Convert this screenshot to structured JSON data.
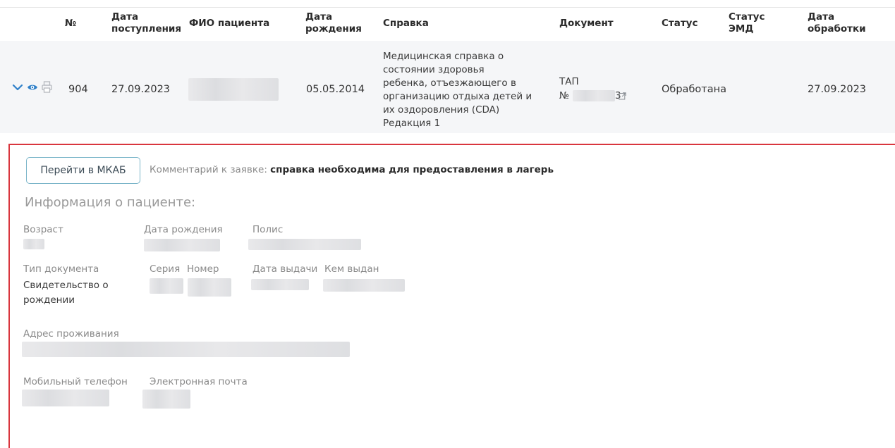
{
  "table": {
    "headers": {
      "num": "№",
      "admission_l1": "Дата",
      "admission_l2": "поступления",
      "patient": "ФИО пациента",
      "birth_l1": "Дата",
      "birth_l2": "рождения",
      "certificate": "Справка",
      "document": "Документ",
      "status": "Статус",
      "emd_l1": "Статус",
      "emd_l2": "ЭМД",
      "processed_l1": "Дата",
      "processed_l2": "обработки"
    },
    "row": {
      "num": "904",
      "admission_date": "27.09.2023",
      "birth_date": "05.05.2014",
      "certificate_lines": [
        "Медицинская справка о",
        "состоянии здоровья",
        "ребенка, отъезжающего в",
        "организацию отдыха детей и",
        "их оздоровления (CDA)",
        "Редакция 1"
      ],
      "document_l1": "ТАП",
      "document_l2_prefix": "№",
      "document_l2_suffix": "3",
      "status": "Обработана",
      "emd_status": "",
      "processed_date": "27.09.2023"
    },
    "colors": {
      "accent": "#2f80c9",
      "highlight_border": "#d9363e"
    }
  },
  "details": {
    "go_button": "Перейти в МКАБ",
    "comment_label": "Комментарий к заявке:",
    "comment_text": "справка необходима для предоставления в лагерь",
    "section_title": "Информация о пациенте:",
    "fields": {
      "age": "Возраст",
      "birth_date": "Дата рождения",
      "policy": "Полис",
      "doc_type": "Тип документа",
      "series": "Серия",
      "number": "Номер",
      "issue_date": "Дата выдачи",
      "issued_by": "Кем выдан",
      "doc_type_value_l1": "Свидетельство о",
      "doc_type_value_l2": "рождении",
      "address": "Адрес проживания",
      "mobile": "Мобильный телефон",
      "email": "Электронная почта"
    }
  }
}
